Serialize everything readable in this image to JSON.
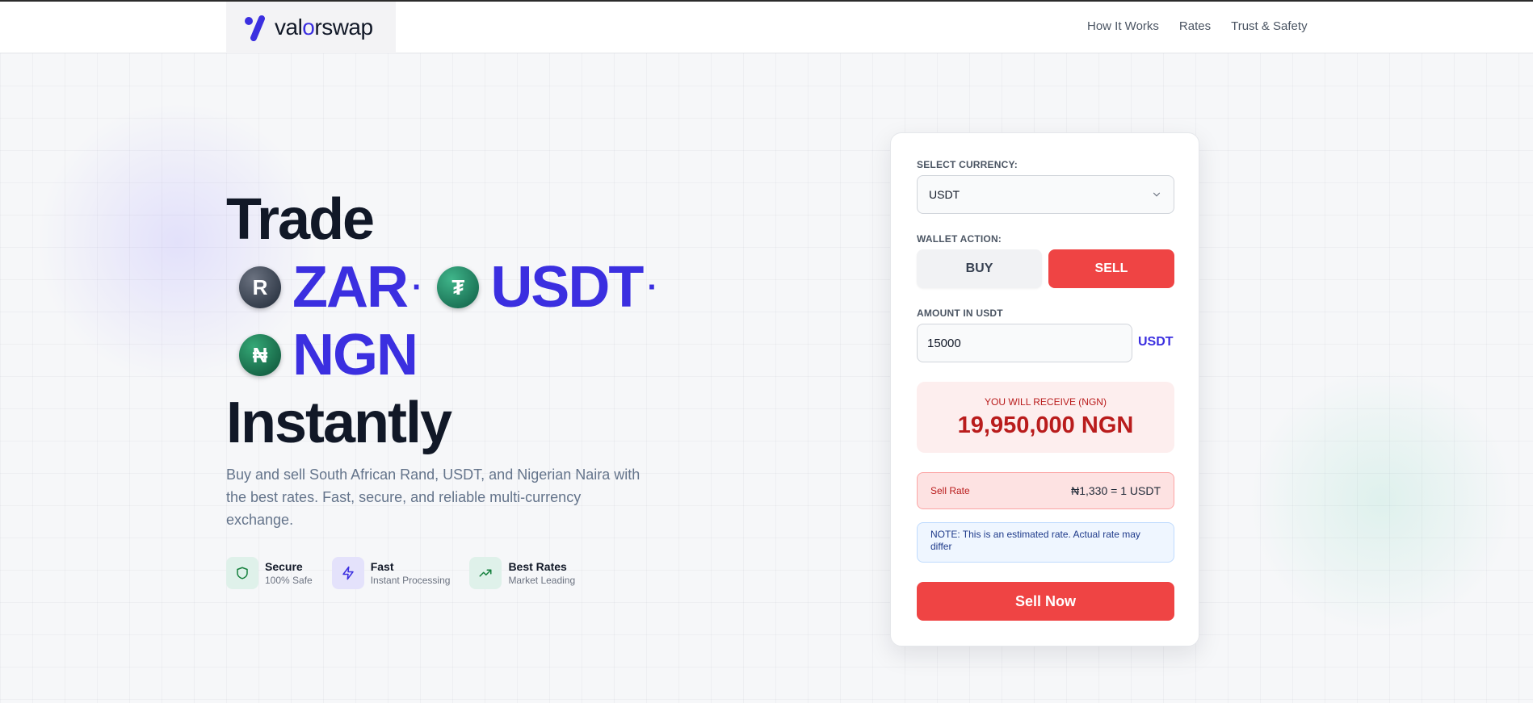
{
  "brand": {
    "name_prefix": "val",
    "name_o": "o",
    "name_suffix": "rswap"
  },
  "nav": {
    "how_it_works": "How It Works",
    "rates": "Rates",
    "trust_safety": "Trust & Safety"
  },
  "hero": {
    "line1": "Trade",
    "currencies": [
      {
        "code": "ZAR",
        "coin_glyph": "R",
        "icon": "zar-coin-icon"
      },
      {
        "code": "USDT",
        "coin_glyph": "₮",
        "icon": "tether-coin-icon"
      },
      {
        "code": "NGN",
        "coin_glyph": "₦",
        "icon": "naira-coin-icon"
      }
    ],
    "separator": "·",
    "line_last": "Instantly",
    "subtitle": "Buy and sell South African Rand, USDT, and Nigerian Naira with the best rates. Fast, secure, and reliable multi-currency exchange."
  },
  "features": [
    {
      "title": "Secure",
      "sub": "100% Safe",
      "icon": "shield-icon",
      "color": "#15803d"
    },
    {
      "title": "Fast",
      "sub": "Instant Processing",
      "icon": "lightning-icon",
      "color": "#3b2fe0"
    },
    {
      "title": "Best Rates",
      "sub": "Market Leading",
      "icon": "trending-up-icon",
      "color": "#15803d"
    }
  ],
  "form": {
    "select_label": "SELECT CURRENCY:",
    "selected_currency": "USDT",
    "wallet_label": "WALLET ACTION:",
    "buy_label": "BUY",
    "sell_label": "SELL",
    "active_action": "SELL",
    "amount_label": "AMOUNT IN USDT",
    "amount_value": "15000",
    "amount_unit": "USDT",
    "receive_label": "YOU WILL RECEIVE (NGN)",
    "receive_value": "19,950,000 NGN",
    "rate_label": "Sell Rate",
    "rate_value": "₦1,330 = 1 USDT",
    "note": "NOTE: This is an estimated rate. Actual rate may differ",
    "action_button": "Sell Now"
  },
  "colors": {
    "accent": "#3b2fe0",
    "sell": "#ef4444",
    "dark": "#111827"
  }
}
